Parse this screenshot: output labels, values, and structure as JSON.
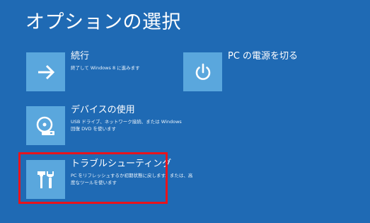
{
  "screen": {
    "title": "オプションの選択"
  },
  "options": [
    {
      "label": "続行",
      "description": "終了して Windows 8 に進みます",
      "icon": "arrow-right-icon"
    },
    {
      "label": "デバイスの使用",
      "description": "USB ドライブ、ネットワーク接続、または Windows 回復 DVD を使います",
      "icon": "disc-drive-icon"
    },
    {
      "label": "トラブルシューティング",
      "description": "PC をリフレッシュするか初期状態に戻します。または、高度なツールを使います",
      "icon": "tools-icon"
    },
    {
      "label": "PC の電源を切る",
      "description": "",
      "icon": "power-icon"
    }
  ],
  "colors": {
    "background": "#1f6ab4",
    "tile": "#5aa7dd",
    "highlight": "#e8141c"
  }
}
